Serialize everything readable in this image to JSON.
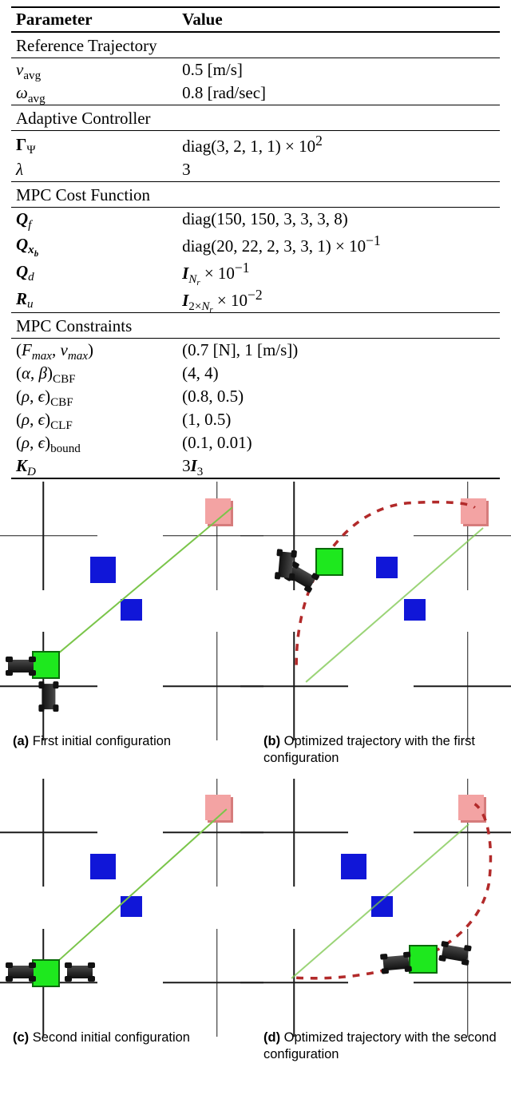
{
  "table": {
    "header_param": "Parameter",
    "header_value": "Value",
    "section1": "Reference Trajectory",
    "vavg_lbl_html": "<span class='ital'>v</span><span class='sub'>avg</span>",
    "vavg_val": "0.5 [m/s]",
    "wavg_lbl_html": "<span class='ital'>ω</span><span class='sub'>avg</span>",
    "wavg_val": "0.8 [rad/sec]",
    "section2": "Adaptive Controller",
    "gamma_lbl_html": "<span class='bold'>Γ</span><span class='sub'>Ψ</span>",
    "gamma_val_html": "diag(3, 2, 1, 1) × 10<sup>2</sup>",
    "lambda_lbl_html": "<span class='ital'>λ</span>",
    "lambda_val": "3",
    "section3": "MPC Cost Function",
    "Qf_lbl_html": "<span class='bolditalic'>Q</span><span class='sub ital'>f</span>",
    "Qf_val": "diag(150, 150, 3, 3, 3, 8)",
    "Qxb_lbl_html": "<span class='bolditalic'>Q</span><span class='sub bolditalic'>x<span class='sub'>b</span></span>",
    "Qxb_val_html": "diag(20, 22, 2, 3, 3, 1) × 10<sup>−1</sup>",
    "Qd_lbl_html": "<span class='bolditalic'>Q</span><span class='sub ital'>d</span>",
    "Qd_val_html": "<span class='bolditalic'>I</span><span class='sub ital'>N<span class='sub'>r</span></span> × 10<sup>−1</sup>",
    "Ru_lbl_html": "<span class='bolditalic'>R</span><span class='sub ital'>u</span>",
    "Ru_val_html": "<span class='bolditalic'>I</span><span class='sub'>2×<span class='ital'>N<span class='sub'>r</span></span></span> × 10<sup>−2</sup>",
    "section4": "MPC Constraints",
    "Fmax_lbl_html": "(<span class='ital'>F<span class='sub'>max</span></span>, <span class='ital'>v<span class='sub'>max</span></span>)",
    "Fmax_val": "(0.7 [N], 1 [m/s])",
    "abCBF_lbl_html": "(<span class='ital'>α</span>, <span class='ital'>β</span>)<span class='sub'>CBF</span>",
    "abCBF_val": "(4, 4)",
    "reCBF_lbl_html": "(<span class='ital'>ρ</span>, <span class='ital'>ϵ</span>)<span class='sub'>CBF</span>",
    "reCBF_val": "(0.8, 0.5)",
    "reCLF_lbl_html": "(<span class='ital'>ρ</span>, <span class='ital'>ϵ</span>)<span class='sub'>CLF</span>",
    "reCLF_val": "(1, 0.5)",
    "reBound_lbl_html": "(<span class='ital'>ρ</span>, <span class='ital'>ϵ</span>)<span class='sub'>bound</span>",
    "reBound_val": "(0.1, 0.01)",
    "KD_lbl_html": "<span class='bolditalic'>K</span><span class='sub ital'>D</span>",
    "KD_val_html": "3<span class='bolditalic'>I</span><span class='sub'>3</span>"
  },
  "figure": {
    "a_tag": "(a)",
    "a_text": "First initial configuration",
    "b_tag": "(b)",
    "b_text": "Optimized trajectory with the first configuration",
    "c_tag": "(c)",
    "c_text": "Second initial configuration",
    "d_tag": "(d)",
    "d_text": "Optimized trajectory with the second configuration"
  }
}
